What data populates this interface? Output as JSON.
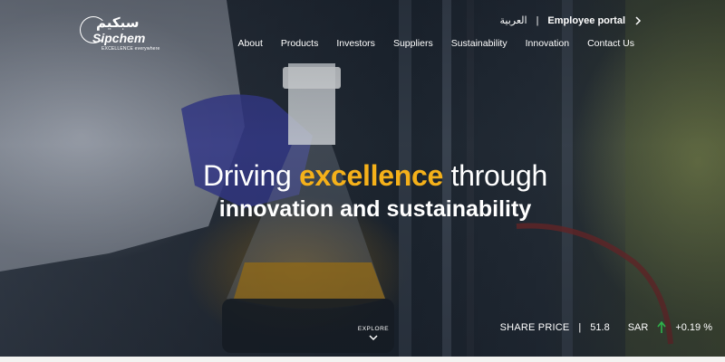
{
  "header": {
    "logo": {
      "arabic": "سبكيم",
      "name": "Sipchem",
      "tagline": "EXCELLENCE everywhere"
    },
    "language_link": "العربية",
    "separator": "|",
    "employee_portal": "Employee portal"
  },
  "nav": {
    "items": [
      "About",
      "Products",
      "Investors",
      "Suppliers",
      "Sustainability",
      "Innovation",
      "Contact Us"
    ]
  },
  "hero": {
    "headline_before": "Driving ",
    "headline_accent": "excellence",
    "headline_after": " through",
    "headline_line2": "innovation and sustainability",
    "accent_color": "#f5b11a"
  },
  "explore": {
    "label": "EXPLORE",
    "icon": "chevron-down-icon"
  },
  "share": {
    "label": "SHARE PRICE",
    "separator": "|",
    "value": "51.8",
    "currency": "SAR",
    "trend_icon": "arrow-up-icon",
    "trend_color": "#2fb24a",
    "change": "+0.19 %"
  }
}
